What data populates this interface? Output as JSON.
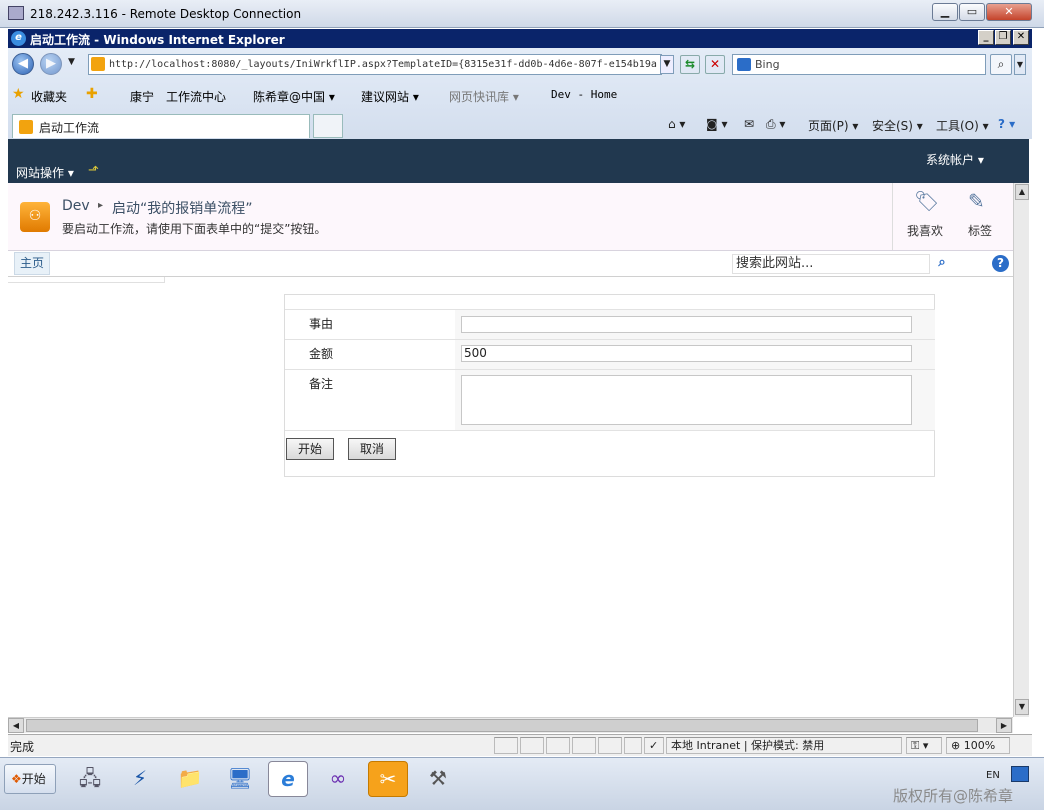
{
  "rdp": {
    "title": "218.242.3.116 - Remote Desktop Connection"
  },
  "ie": {
    "title": "启动工作流 - Windows Internet Explorer",
    "address": "http://localhost:8080/_layouts/IniWrkflIP.aspx?TemplateID={8315e31f-dd0b-4d6e-807f-e154b19a",
    "search_placeholder": "Bing",
    "favorites": {
      "label": "收藏夹",
      "items": [
        "康宁",
        "工作流中心",
        "陈希章@中国 ▾",
        "建议网站 ▾",
        "网页快讯库 ▾",
        "Dev - Home"
      ]
    },
    "tab_label": "启动工作流",
    "commands": [
      "页面(P) ▾",
      "安全(S) ▾",
      "工具(O) ▾"
    ]
  },
  "sharepoint": {
    "site_actions": "网站操作 ▾",
    "account": "系统帐户 ▾",
    "breadcrumb_site": "Dev",
    "breadcrumb_page": "启动“我的报销单流程”",
    "description": "要启动工作流，请使用下面表单中的“提交”按钮。",
    "like_label": "我喜欢",
    "tag_label": "标签",
    "home_tab": "主页",
    "search_placeholder": "搜索此网站...",
    "help_glyph": "?"
  },
  "form": {
    "fields": [
      {
        "label": "事由",
        "value": ""
      },
      {
        "label": "金额",
        "value": "500"
      },
      {
        "label": "备注",
        "value": ""
      }
    ],
    "start_button": "开始",
    "cancel_button": "取消"
  },
  "status": {
    "text": "完成",
    "zone": "本地 Intranet | 保护模式: 禁用",
    "zoom": "100%"
  },
  "taskbar": {
    "start": "开始",
    "lang": "EN",
    "watermark": "版权所有@陈希章"
  }
}
